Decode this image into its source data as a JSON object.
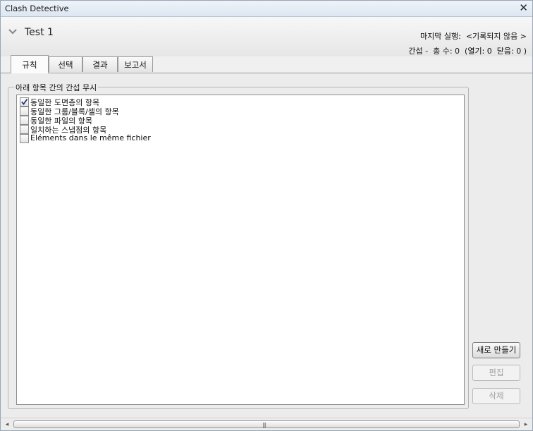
{
  "window": {
    "title": "Clash Detective",
    "close_glyph": "✕"
  },
  "header": {
    "test_name": "Test 1",
    "last_run": "마지막 실행:  <기록되지 않음 >",
    "clash_count": "간섭 -  총 수: 0  (열기: 0  닫음: 0 )"
  },
  "tabs": [
    {
      "label": "규칙",
      "active": true
    },
    {
      "label": "선택",
      "active": false
    },
    {
      "label": "결과",
      "active": false
    },
    {
      "label": "보고서",
      "active": false
    }
  ],
  "ignore_group": {
    "legend": "아래 항목 간의 간섭 무시",
    "items": [
      {
        "label": "동일한 도면층의 항목",
        "checked": true
      },
      {
        "label": "동일한 그룹/블록/셀의 항목",
        "checked": false
      },
      {
        "label": "동일한 파일의 항목",
        "checked": false
      },
      {
        "label": "일치하는 스냅점의 항목",
        "checked": false
      },
      {
        "label": "Eléments dans le même fichier",
        "checked": false
      }
    ]
  },
  "buttons": {
    "new": "새로 만들기",
    "edit": "편집",
    "delete": "삭제"
  },
  "scrollbar": {
    "left_arrow": "◂",
    "right_arrow": "▸",
    "grip": "|||"
  },
  "icons": {
    "collapse": "chevron-down-icon",
    "check": "check-icon",
    "close": "close-icon"
  },
  "colors": {
    "title_bar": "#dde6f1",
    "check_mark": "#1f3d7a",
    "disabled_text": "#a0a0a0"
  }
}
